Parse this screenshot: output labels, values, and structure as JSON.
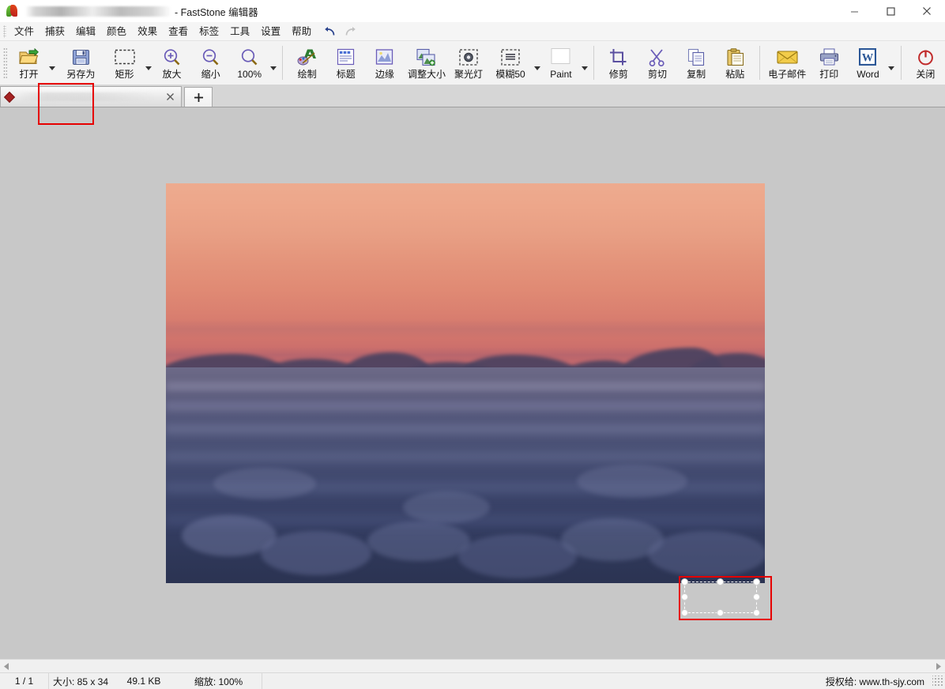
{
  "window": {
    "title_suffix": "- FastStone 编辑器",
    "filename_redacted": "",
    "logo_icon": "faststone-leaf-logo",
    "controls": [
      {
        "name": "minimize-button",
        "glyph": "minimize-icon"
      },
      {
        "name": "maximize-button",
        "glyph": "maximize-icon"
      },
      {
        "name": "close-button",
        "glyph": "close-icon"
      }
    ]
  },
  "menubar": {
    "items": [
      {
        "label": "文件",
        "name": "menu-file"
      },
      {
        "label": "捕获",
        "name": "menu-capture"
      },
      {
        "label": "编辑",
        "name": "menu-edit"
      },
      {
        "label": "颜色",
        "name": "menu-color"
      },
      {
        "label": "效果",
        "name": "menu-effects"
      },
      {
        "label": "查看",
        "name": "menu-view"
      },
      {
        "label": "标签",
        "name": "menu-tags"
      },
      {
        "label": "工具",
        "name": "menu-tools"
      },
      {
        "label": "设置",
        "name": "menu-settings"
      },
      {
        "label": "帮助",
        "name": "menu-help"
      }
    ],
    "undo": {
      "name": "undo-icon",
      "enabled": true
    },
    "redo": {
      "name": "redo-icon",
      "enabled": false
    }
  },
  "toolbar": {
    "buttons": [
      {
        "label": "打开",
        "name": "open-button",
        "icon": "open-folder-icon",
        "dropdown": true
      },
      {
        "label": "另存为",
        "name": "save-as-button",
        "icon": "floppy-disk-icon",
        "dropdown": false,
        "highlighted": true
      },
      {
        "label": "矩形",
        "name": "rectangle-select-button",
        "icon": "marquee-rect-icon",
        "dropdown": true
      },
      {
        "label": "放大",
        "name": "zoom-in-button",
        "icon": "zoom-in-icon",
        "dropdown": false
      },
      {
        "label": "缩小",
        "name": "zoom-out-button",
        "icon": "zoom-out-icon",
        "dropdown": false
      },
      {
        "label": "100%",
        "name": "zoom-100-button",
        "icon": "magnifier-icon",
        "dropdown": true
      },
      {
        "label": "绘制",
        "name": "draw-button",
        "icon": "paint-brush-a-icon",
        "dropdown": false
      },
      {
        "label": "标题",
        "name": "caption-button",
        "icon": "caption-icon",
        "dropdown": false
      },
      {
        "label": "边缘",
        "name": "edge-button",
        "icon": "edge-frame-icon",
        "dropdown": false
      },
      {
        "label": "调整大小",
        "name": "resize-button",
        "icon": "resize-image-icon",
        "dropdown": false
      },
      {
        "label": "聚光灯",
        "name": "spotlight-button",
        "icon": "spotlight-icon",
        "dropdown": false
      },
      {
        "label": "模糊50",
        "name": "blur50-button",
        "icon": "blur-icon",
        "dropdown": true
      },
      {
        "label": "Paint",
        "name": "paint-button",
        "icon": "blank-page-icon",
        "dropdown": true
      },
      {
        "label": "修剪",
        "name": "crop-button",
        "icon": "crop-icon",
        "dropdown": false
      },
      {
        "label": "剪切",
        "name": "cut-button",
        "icon": "scissors-icon",
        "dropdown": false
      },
      {
        "label": "复制",
        "name": "copy-button",
        "icon": "copy-pages-icon",
        "dropdown": false
      },
      {
        "label": "粘贴",
        "name": "paste-button",
        "icon": "clipboard-icon",
        "dropdown": false
      },
      {
        "label": "电子邮件",
        "name": "email-button",
        "icon": "envelope-icon",
        "dropdown": false
      },
      {
        "label": "打印",
        "name": "print-button",
        "icon": "printer-icon",
        "dropdown": false
      },
      {
        "label": "Word",
        "name": "word-button",
        "icon": "word-w-icon",
        "dropdown": true
      },
      {
        "label": "关闭",
        "name": "close-doc-button",
        "icon": "power-off-icon",
        "dropdown": false
      }
    ],
    "annotation_color": "#e60000"
  },
  "tabstrip": {
    "tab": {
      "name": "document-tab",
      "label_redacted": "",
      "marker_icon": "red-diamond-icon",
      "close_icon": "close-tab-icon"
    },
    "new_tab": {
      "name": "new-tab-button",
      "glyph": "+"
    }
  },
  "canvas": {
    "background_color": "#c8c8c8",
    "image": {
      "name": "photo-sea-of-clouds-at-sunset",
      "alt": "Sunset sky above a sea of clouds",
      "sky_top_color": "#edab8f",
      "sky_bottom_color": "#b56070",
      "cloud_top_color": "#6d6a88",
      "cloud_bottom_color": "#2b3352"
    },
    "selection": {
      "name": "image-selection-rectangle",
      "handle_count": 8,
      "annotation_color": "#e60000"
    }
  },
  "scrollbar": {
    "left_arrow": {
      "name": "scroll-left-arrow"
    },
    "right_arrow": {
      "name": "scroll-right-arrow"
    }
  },
  "statusbar": {
    "page": "1 / 1",
    "size": "大小: 85 x 34",
    "filesize": "49.1 KB",
    "zoom": "缩放: 100%",
    "license": "授权给: www.th-sjy.com"
  }
}
